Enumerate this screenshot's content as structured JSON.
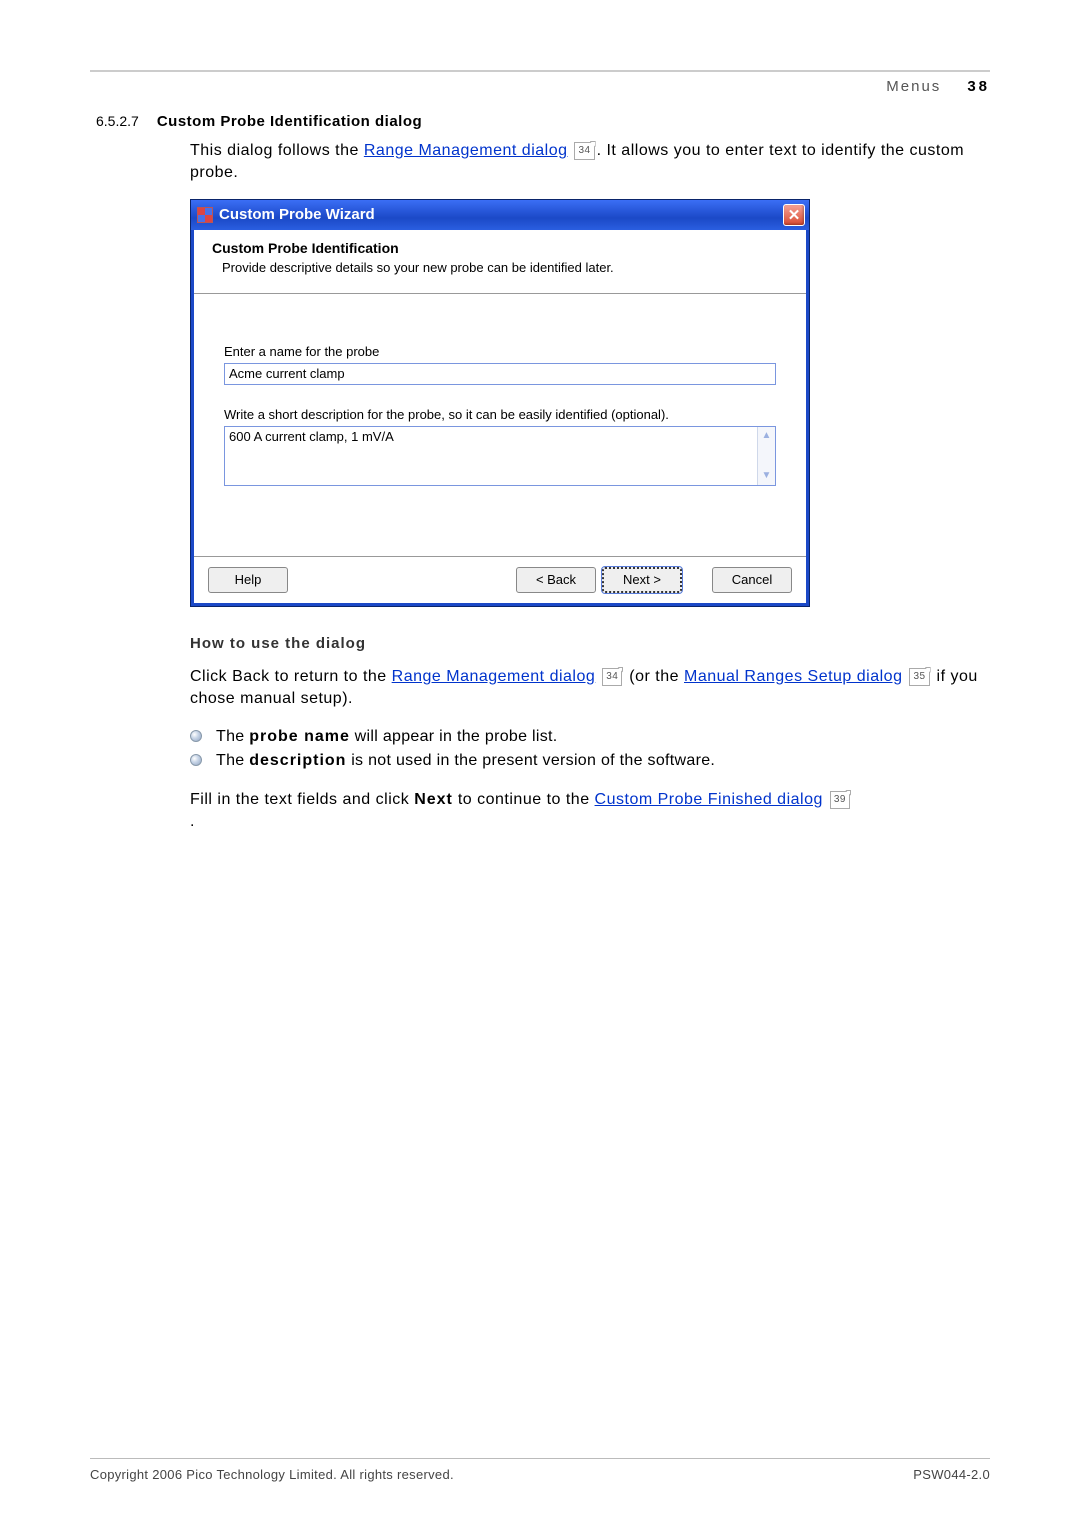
{
  "header": {
    "section_label": "Menus",
    "page_number": "38"
  },
  "section": {
    "number": "6.5.2.7",
    "title": "Custom Probe Identification dialog"
  },
  "intro": {
    "pre": "This dialog follows the ",
    "link1": "Range Management dialog",
    "ref1": "34",
    "post": ". It allows you to enter text to identify the custom probe."
  },
  "wizard": {
    "title": "Custom Probe Wizard",
    "sub_title": "Custom Probe Identification",
    "sub_desc": "Provide descriptive details so your new probe can be identified later.",
    "name_label": "Enter a name for the probe",
    "name_value": "Acme current clamp",
    "desc_label": "Write a short description for the probe, so it can be easily identified (optional).",
    "desc_value": "600 A current clamp, 1 mV/A",
    "buttons": {
      "help": "Help",
      "back": "< Back",
      "next": "Next >",
      "cancel": "Cancel"
    }
  },
  "howto_heading": "How to use the dialog",
  "para2": {
    "pre": "Click Back to return to the ",
    "link1": "Range Management dialog",
    "ref1": "34",
    "mid": " (or the ",
    "link2": "Manual Ranges Setup dialog",
    "ref2": "35",
    "post": " if you chose manual setup)."
  },
  "bullets": {
    "b1_bold": "probe name",
    "b1_rest": " will appear in the probe list.",
    "b1_pre": "The ",
    "b2_pre": "The ",
    "b2_bold": "description",
    "b2_rest": " is not used in the present version of the software."
  },
  "para3": {
    "pre": "Fill in the text fields and click ",
    "bold": "Next",
    "mid": " to continue to the ",
    "link": "Custom Probe Finished dialog",
    "ref": "39",
    "post": "."
  },
  "footer": {
    "left": "Copyright 2006 Pico Technology Limited. All rights reserved.",
    "right": "PSW044-2.0"
  }
}
